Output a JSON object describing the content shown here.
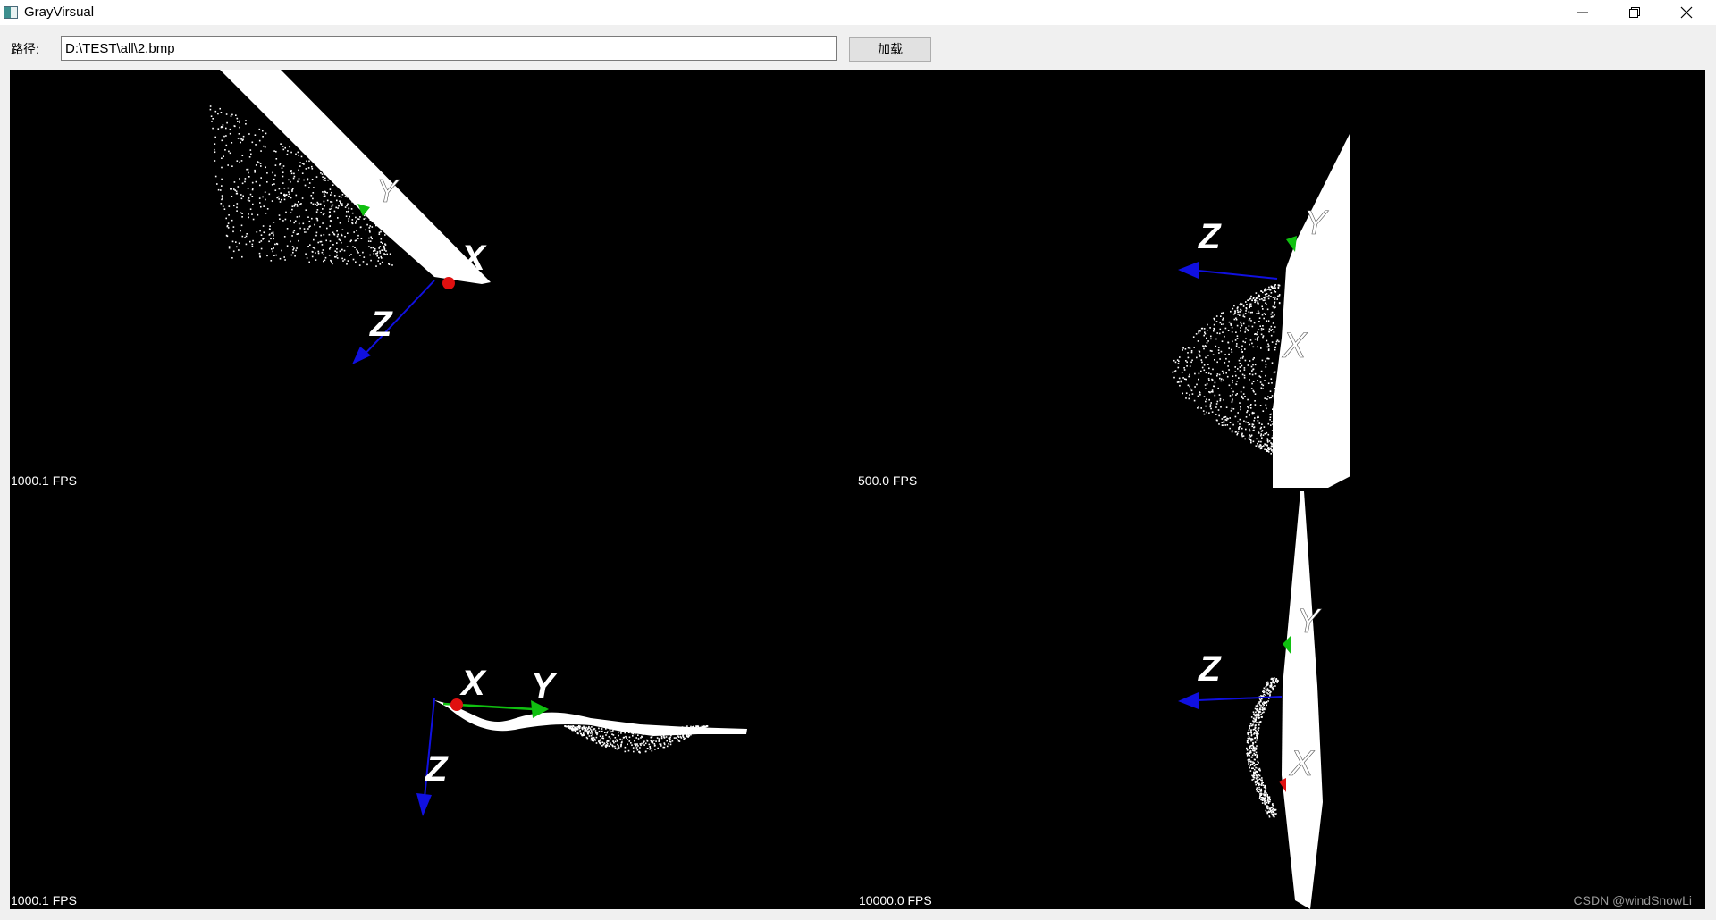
{
  "window": {
    "title": "GrayVirsual",
    "icon": "app-window-icon",
    "controls": [
      "minimize-icon",
      "restore-icon",
      "close-icon"
    ]
  },
  "toolbar": {
    "path_label": "路径:",
    "path_value": "D:\\TEST\\all\\2.bmp",
    "load_label": "加载"
  },
  "views": [
    {
      "fps": "1000.1 FPS"
    },
    {
      "fps": "500.0 FPS"
    },
    {
      "fps": "1000.1 FPS"
    },
    {
      "fps": "10000.0 FPS"
    }
  ],
  "axes": {
    "x": "X",
    "y": "Y",
    "z": "Z"
  },
  "colors": {
    "background": "#000000",
    "x_axis": "#e01010",
    "y_axis": "#10c010",
    "z_axis": "#1010e0",
    "cloud": "#ffffff"
  },
  "watermark": "CSDN @windSnowLi"
}
